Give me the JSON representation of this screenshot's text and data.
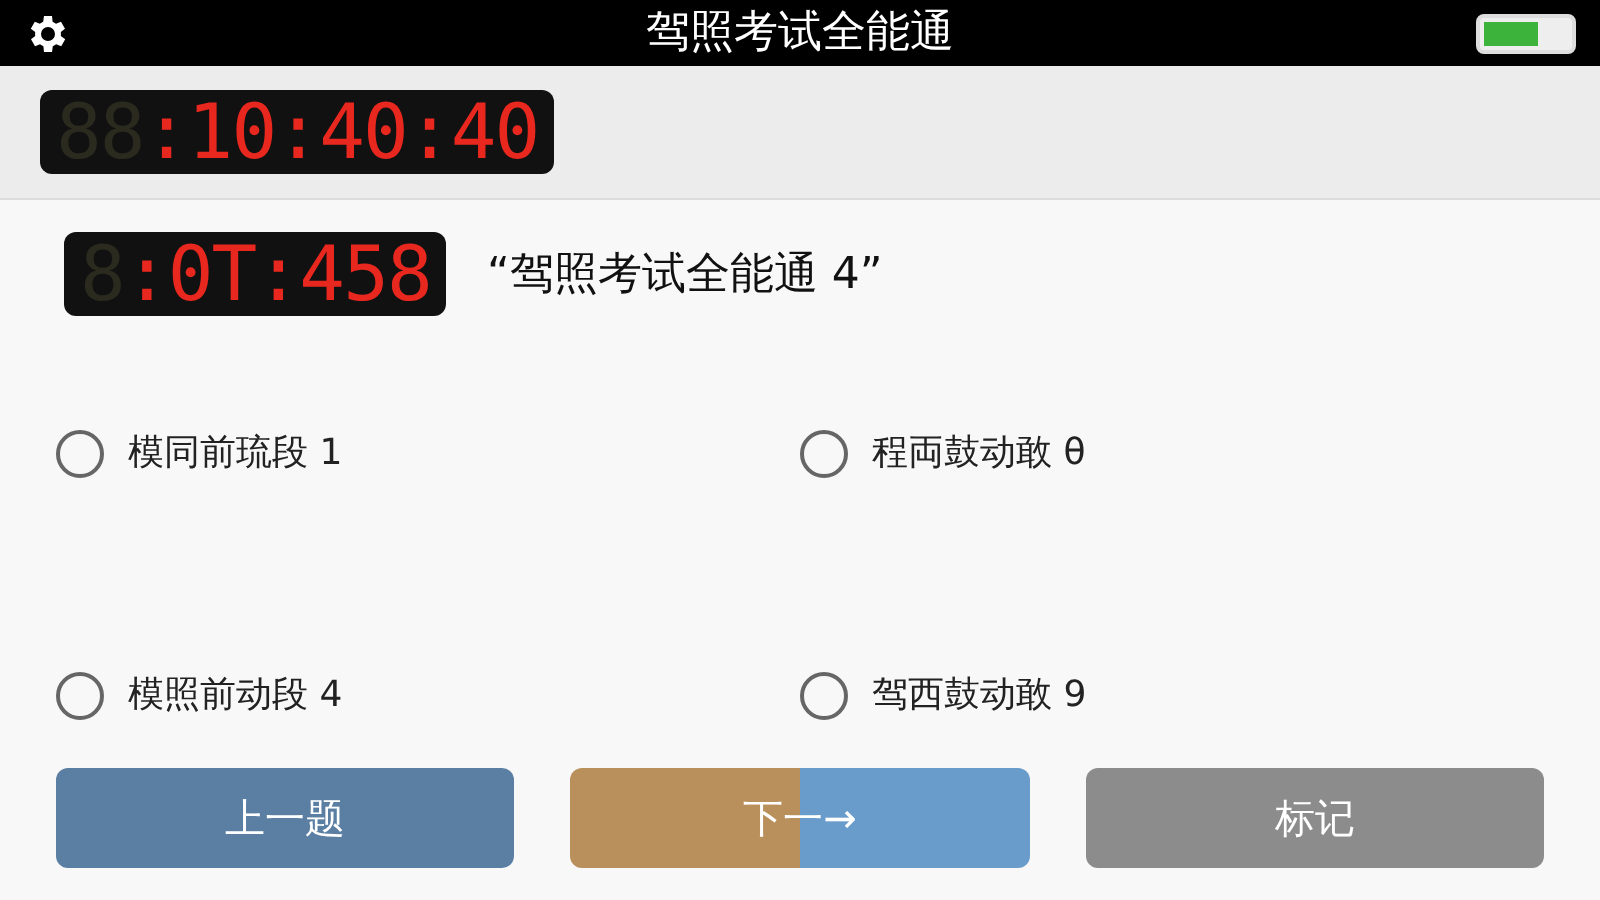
{
  "title_bar": {
    "title": "驾照考试全能通"
  },
  "clock": {
    "dim": "88",
    "lit": ":10:40:40"
  },
  "question": {
    "timer_dim": "8",
    "timer_lit": ":0T:458",
    "text": "“驾照考试全能通 4”"
  },
  "options": [
    {
      "label": "模同前琉段 1",
      "selected": false
    },
    {
      "label": "程両鼓动敢 θ",
      "selected": false
    },
    {
      "label": "模照前动段 4",
      "selected": false
    },
    {
      "label": "驾西鼓动敢 9",
      "selected": false
    }
  ],
  "buttons": [
    {
      "label": "上一题",
      "kind": "prev"
    },
    {
      "label": "下一→",
      "kind": "next"
    },
    {
      "label": "标记",
      "kind": "mark"
    }
  ]
}
